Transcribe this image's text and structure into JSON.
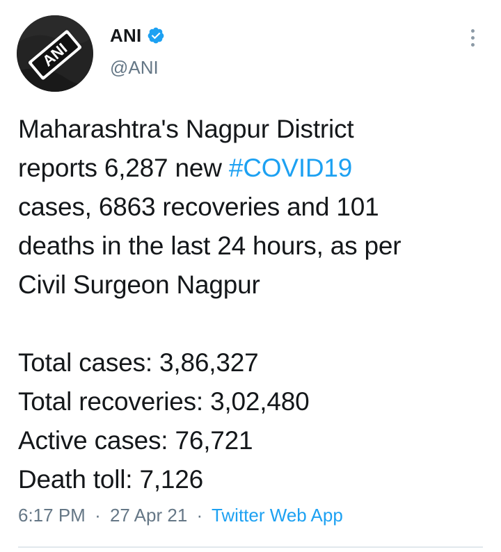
{
  "author": {
    "display_name": "ANI",
    "handle": "@ANI",
    "avatar_logo_text": "ANI",
    "verified": true
  },
  "tweet": {
    "lines": [
      [
        "Maharashtra's Nagpur District"
      ],
      [
        "reports 6,287 new ",
        "#COVID19"
      ],
      [
        "cases, 6863 recoveries and 101"
      ],
      [
        "deaths in the last 24 hours, as per"
      ],
      [
        "Civil Surgeon Nagpur"
      ]
    ],
    "line1": "Maharashtra's Nagpur District",
    "line2_prefix": "reports 6,287 new ",
    "hashtag": "#COVID19",
    "line3": "cases, 6863 recoveries and 101",
    "line4": "deaths in the last 24 hours, as per",
    "line5": "Civil Surgeon Nagpur",
    "stats": {
      "total_cases": "Total cases: 3,86,327",
      "total_recoveries": "Total recoveries: 3,02,480",
      "active_cases": "Active cases: 76,721",
      "death_toll": "Death toll: 7,126"
    }
  },
  "meta": {
    "time": "6:17 PM",
    "separator": "·",
    "date": "27 Apr 21",
    "source": "Twitter Web App"
  },
  "colors": {
    "link": "#1da1f2",
    "secondary_text": "#657786",
    "primary_text": "#14171a",
    "verified_badge": "#1da1f2"
  },
  "icons": {
    "verified": "verified-badge-icon",
    "more": "more-vertical-icon"
  }
}
